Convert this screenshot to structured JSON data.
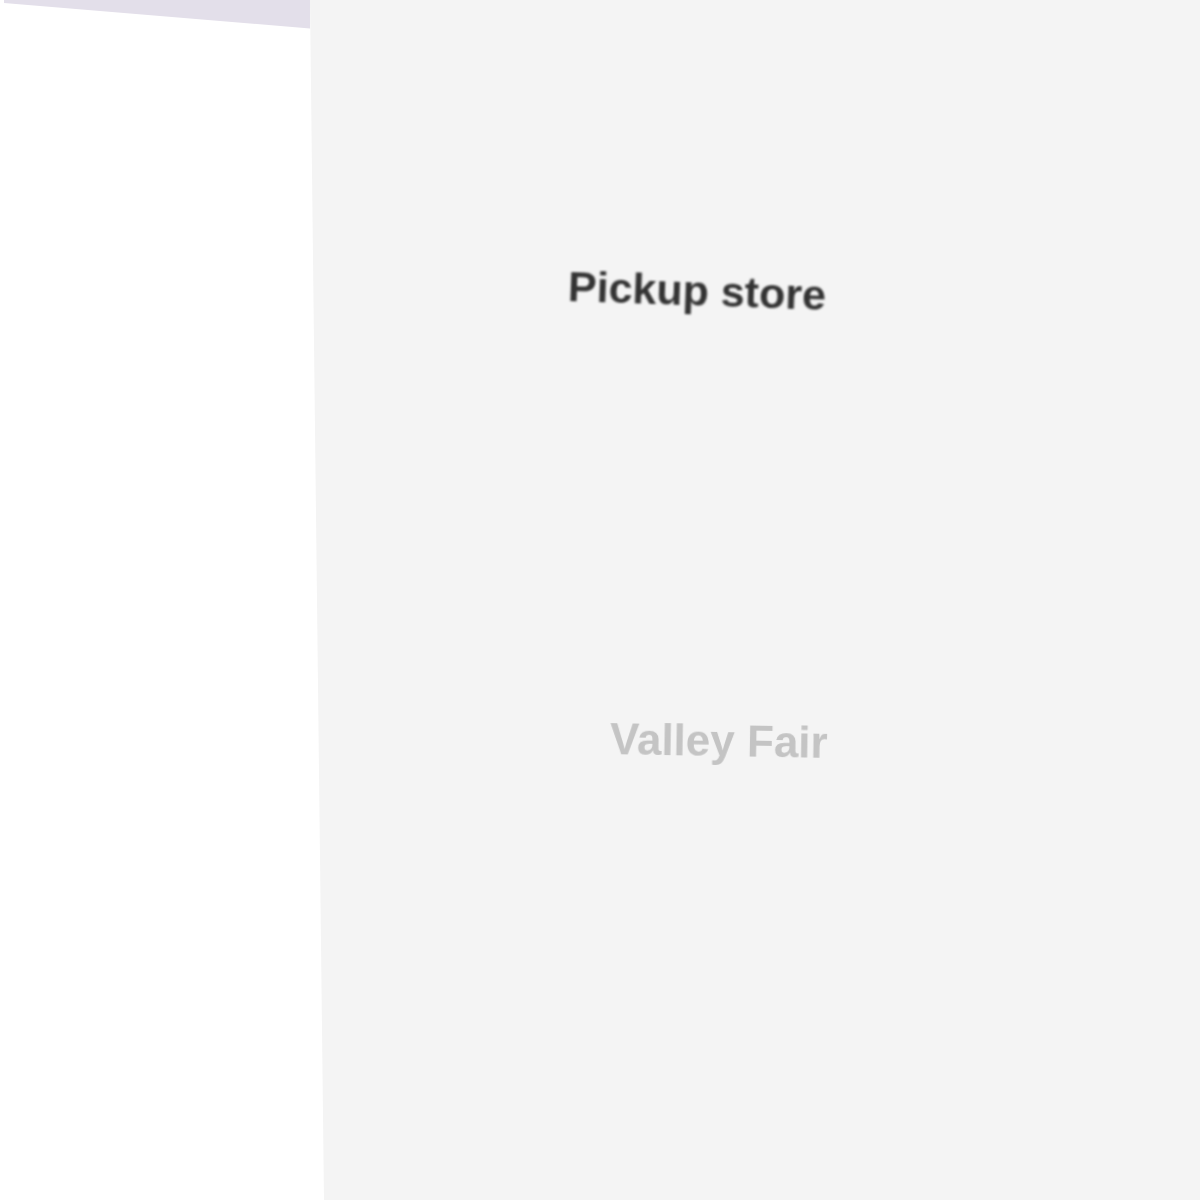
{
  "panel": {
    "title": "Pickup store",
    "store": {
      "name": "Valley Fair"
    }
  }
}
